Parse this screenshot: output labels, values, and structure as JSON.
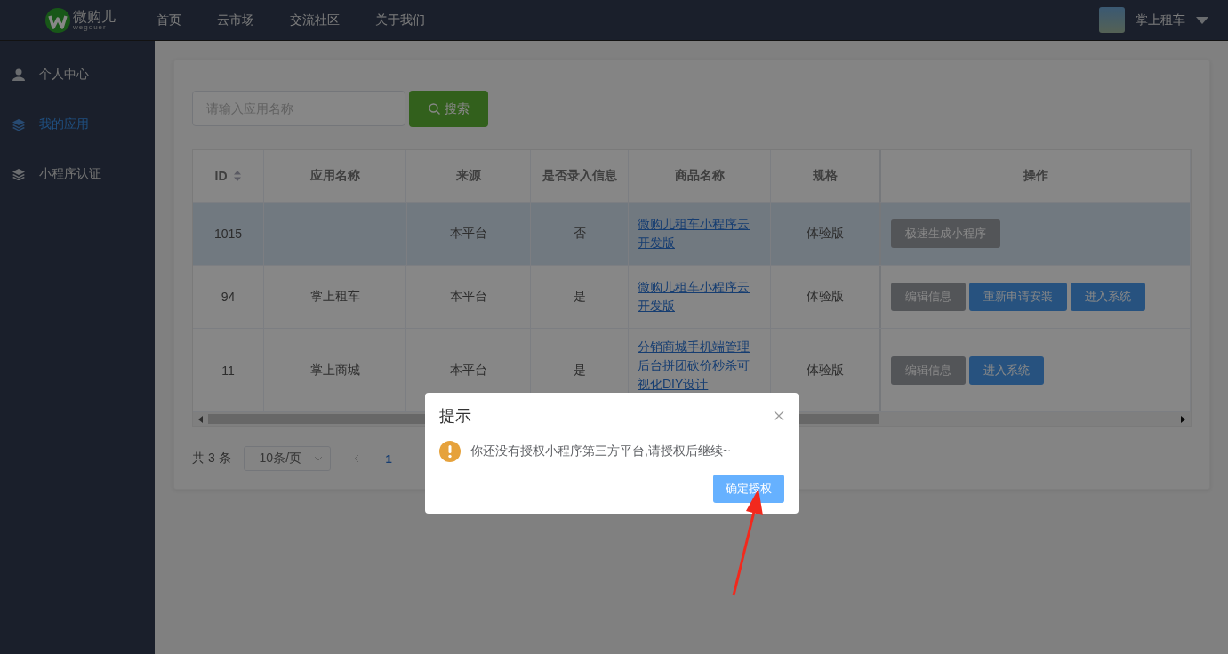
{
  "header": {
    "logo": {
      "name": "微购儿",
      "sub": "wegouer"
    },
    "nav": [
      {
        "label": "首页"
      },
      {
        "label": "云市场"
      },
      {
        "label": "交流社区"
      },
      {
        "label": "关于我们"
      }
    ],
    "user": {
      "name": "掌上租车"
    }
  },
  "sidebar": {
    "items": [
      {
        "label": "个人中心",
        "selected": false
      },
      {
        "label": "我的应用",
        "selected": true
      },
      {
        "label": "小程序认证",
        "selected": false
      }
    ]
  },
  "search": {
    "placeholder": "请输入应用名称",
    "button": "搜索"
  },
  "table": {
    "columns": [
      {
        "label": "ID",
        "sortable": true
      },
      {
        "label": "应用名称",
        "sortable": false
      },
      {
        "label": "来源",
        "sortable": false
      },
      {
        "label": "是否录入信息",
        "sortable": false
      },
      {
        "label": "商品名称",
        "sortable": false
      },
      {
        "label": "规格",
        "sortable": false
      },
      {
        "label": "操作",
        "sortable": false
      }
    ],
    "rows": [
      {
        "highlighted": true,
        "id": "1015",
        "name": "",
        "source": "本平台",
        "entered": "否",
        "product": "微购儿租车小程序云开发版",
        "spec": "体验版",
        "actions": [
          {
            "label": "极速生成小程序",
            "kind": "secondary"
          }
        ]
      },
      {
        "highlighted": false,
        "id": "94",
        "name": "掌上租车",
        "source": "本平台",
        "entered": "是",
        "product": "微购儿租车小程序云开发版",
        "spec": "体验版",
        "actions": [
          {
            "label": "编辑信息",
            "kind": "secondary"
          },
          {
            "label": "重新申请安装",
            "kind": "primary"
          },
          {
            "label": "进入系统",
            "kind": "primary"
          }
        ]
      },
      {
        "highlighted": false,
        "id": "11",
        "name": "掌上商城",
        "source": "本平台",
        "entered": "是",
        "product": "分销商城手机端管理后台拼团砍价秒杀可视化DIY设计",
        "spec": "体验版",
        "actions": [
          {
            "label": "编辑信息",
            "kind": "secondary"
          },
          {
            "label": "进入系统",
            "kind": "primary"
          }
        ]
      }
    ]
  },
  "pagination": {
    "total": "共 3 条",
    "page_size": "10条/页",
    "pages": [
      {
        "label": "1",
        "selected": true
      }
    ]
  },
  "dialog": {
    "title": "提示",
    "message": "你还没有授权小程序第三方平台,请授权后继续~",
    "confirm": "确定授权"
  }
}
